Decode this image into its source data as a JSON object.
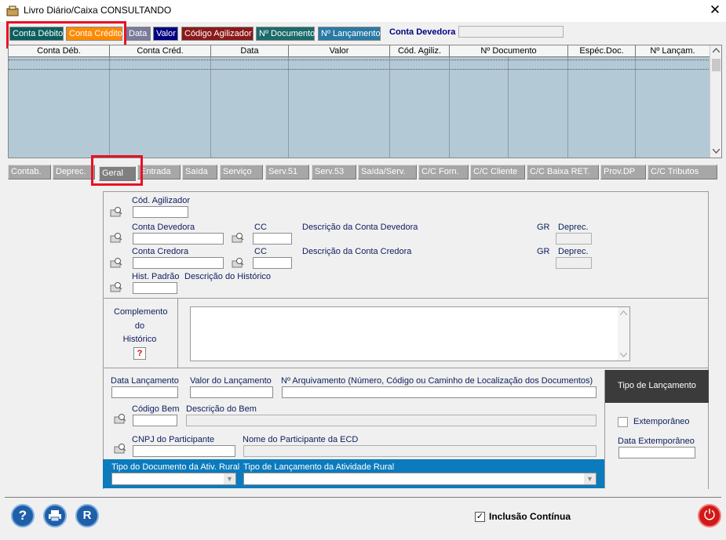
{
  "window": {
    "title": "Livro Diário/Caixa   CONSULTANDO",
    "close_glyph": "✕"
  },
  "sort_tabs": [
    {
      "label": "Conta Débito",
      "color": "#0c5e5e"
    },
    {
      "label": "Conta Crédito",
      "color": "#ff8a00"
    },
    {
      "label": "Data",
      "color": "#7a7a9a"
    },
    {
      "label": "Valor",
      "color": "#000080"
    },
    {
      "label": "Código Agilizador",
      "color": "#8b1a1a"
    },
    {
      "label": "Nº Documento",
      "color": "#1c6b6b"
    },
    {
      "label": "Nº Lançamento",
      "color": "#2a7aa5"
    }
  ],
  "conta_devedora_label": "Conta Devedora",
  "grid": {
    "columns": [
      "Conta Déb.",
      "Conta Créd.",
      "Data",
      "Valor",
      "Cód. Agiliz.",
      "Nº Documento",
      "Espéc.Doc.",
      "Nº Lançam."
    ]
  },
  "lower_tabs": [
    "Contab.",
    "Deprec.",
    "Geral",
    "Entrada",
    "Saída",
    "Serviço",
    "Serv.51",
    "Serv.53",
    "Saída/Serv.",
    "C/C Forn.",
    "C/C Cliente",
    "C/C Baixa RET.",
    "Prov.DP",
    "C/C Tributos"
  ],
  "form": {
    "cod_agilizador": "Cód. Agilizador",
    "conta_devedora": "Conta Devedora",
    "cc": "CC",
    "desc_conta_devedora": "Descrição da Conta Devedora",
    "gr": "GR",
    "deprec": "Deprec.",
    "conta_credora": "Conta Credora",
    "desc_conta_credora": "Descrição da Conta Credora",
    "hist_padrao": "Hist. Padrão",
    "desc_historico": "Descrição do Histórico",
    "complemento": [
      "Complemento",
      "do",
      "Histórico"
    ],
    "help_glyph": "?",
    "data_lancamento": "Data Lançamento",
    "valor_lancamento": "Valor do Lançamento",
    "arquivamento": "Nº Arquivamento (Número, Código ou Caminho de Localização dos Documentos)",
    "tipo_lancamento": "Tipo de Lançamento",
    "codigo_bem": "Código Bem",
    "descricao_bem": "Descrição do Bem",
    "extemporaneo": "Extemporâneo",
    "data_extemporaneo": "Data Extemporâneo",
    "cnpj_participante": "CNPJ do Participante",
    "nome_participante": "Nome do Participante da ECD",
    "tipo_doc_rural": "Tipo do Documento da Ativ. Rural",
    "tipo_lanc_rural": "Tipo de Lançamento da Atividade Rural"
  },
  "bottom": {
    "inclusao_continua": "Inclusão Contínua",
    "inclusao_checked": "✓",
    "help_glyph": "?",
    "report_glyph": "R",
    "power_glyph": "⏻"
  }
}
